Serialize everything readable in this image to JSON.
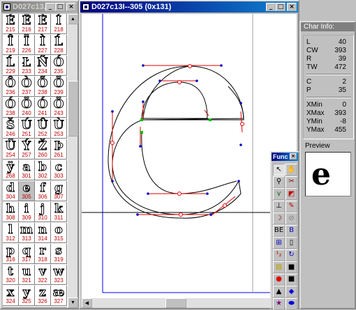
{
  "charset_window": {
    "title": "D027c13...",
    "buttons": [
      "_",
      "□",
      "×"
    ],
    "cells": [
      {
        "glyph": "É",
        "code": "215"
      },
      {
        "glyph": "Ë",
        "code": "216"
      },
      {
        "glyph": "È",
        "code": "217"
      },
      {
        "glyph": "Í",
        "code": "218"
      },
      {
        "glyph": "Î",
        "code": "219"
      },
      {
        "glyph": "Ï",
        "code": "226"
      },
      {
        "glyph": "Ì",
        "code": "227"
      },
      {
        "glyph": "Ĺ",
        "code": "228"
      },
      {
        "glyph": "Ĺ",
        "code": "229"
      },
      {
        "glyph": "Ł",
        "code": "233"
      },
      {
        "glyph": "Ñ",
        "code": "234"
      },
      {
        "glyph": "Ó",
        "code": "235"
      },
      {
        "glyph": "Ô",
        "code": "236"
      },
      {
        "glyph": "Ò",
        "code": "237"
      },
      {
        "glyph": "Õ",
        "code": "238"
      },
      {
        "glyph": "Ö",
        "code": "239"
      },
      {
        "glyph": "Ó",
        "code": "238"
      },
      {
        "glyph": "Ö",
        "code": "240"
      },
      {
        "glyph": "Ó",
        "code": "241"
      },
      {
        "glyph": "Ö",
        "code": "243"
      },
      {
        "glyph": "Š",
        "code": "246"
      },
      {
        "glyph": "Ú",
        "code": "251"
      },
      {
        "glyph": "Û",
        "code": "252"
      },
      {
        "glyph": "Ù",
        "code": "253"
      },
      {
        "glyph": "Ü",
        "code": "254"
      },
      {
        "glyph": "Ý",
        "code": "257"
      },
      {
        "glyph": "Ž",
        "code": "260"
      },
      {
        "glyph": "Þ",
        "code": "261"
      },
      {
        "glyph": "ÿ",
        "code": "268"
      },
      {
        "glyph": "a",
        "code": "301"
      },
      {
        "glyph": "b",
        "code": "302"
      },
      {
        "glyph": "c",
        "code": "303"
      },
      {
        "glyph": "d",
        "code": "304"
      },
      {
        "glyph": "e",
        "code": "305",
        "selected": true
      },
      {
        "glyph": "f",
        "code": "306"
      },
      {
        "glyph": "g",
        "code": "307"
      },
      {
        "glyph": "h",
        "code": "308"
      },
      {
        "glyph": "i",
        "code": "309"
      },
      {
        "glyph": "j",
        "code": "310"
      },
      {
        "glyph": "k",
        "code": "311"
      },
      {
        "glyph": "l",
        "code": "312"
      },
      {
        "glyph": "m",
        "code": "313"
      },
      {
        "glyph": "n",
        "code": "314"
      },
      {
        "glyph": "o",
        "code": "315"
      },
      {
        "glyph": "p",
        "code": "316"
      },
      {
        "glyph": "q",
        "code": "317"
      },
      {
        "glyph": "r",
        "code": "318"
      },
      {
        "glyph": "s",
        "code": "319"
      },
      {
        "glyph": "t",
        "code": "320"
      },
      {
        "glyph": "u",
        "code": "321"
      },
      {
        "glyph": "v",
        "code": "322"
      },
      {
        "glyph": "w",
        "code": "323"
      },
      {
        "glyph": "x",
        "code": "324"
      },
      {
        "glyph": "y",
        "code": "325"
      },
      {
        "glyph": "z",
        "code": "326"
      },
      {
        "glyph": "æ",
        "code": "327"
      }
    ]
  },
  "editor_window": {
    "title": "D027c13I--305 (0x131)",
    "buttons": [
      "_",
      "□",
      "×"
    ]
  },
  "char_info": {
    "title": "Char Info:",
    "metrics": [
      {
        "label": "L",
        "value": "40"
      },
      {
        "label": "CW",
        "value": "393"
      },
      {
        "label": "R",
        "value": "39"
      },
      {
        "label": "TW",
        "value": "472"
      }
    ],
    "counts": [
      {
        "label": "C",
        "value": "2"
      },
      {
        "label": "P",
        "value": "35"
      }
    ],
    "bounds": [
      {
        "label": "XMin",
        "value": "0"
      },
      {
        "label": "XMax",
        "value": "393"
      },
      {
        "label": "YMin",
        "value": "-8"
      },
      {
        "label": "YMax",
        "value": "455"
      }
    ],
    "preview_label": "Preview",
    "preview_glyph": "e"
  },
  "func_palette": {
    "title": "Func",
    "tools": [
      {
        "name": "pointer-tool-icon",
        "glyph": "↖",
        "color": "#000000"
      },
      {
        "name": "hand-tool-icon",
        "glyph": "✋",
        "color": "#c08000"
      },
      {
        "name": "zoom-tool-icon",
        "glyph": "⚲",
        "color": "#000000"
      },
      {
        "name": "knife-tool-icon",
        "glyph": "✂",
        "color": "#800000"
      },
      {
        "name": "node-tool-icon",
        "glyph": "⋎",
        "color": "#006000"
      },
      {
        "name": "transform-tool-icon",
        "glyph": "◩",
        "color": "#c00000"
      },
      {
        "name": "measure-tool-icon",
        "glyph": "⊥",
        "color": "#000000"
      },
      {
        "name": "pen-tool-icon",
        "glyph": "✎",
        "color": "#c00000"
      },
      {
        "name": "curve-tool-icon",
        "glyph": "☽",
        "color": "#800000"
      },
      {
        "name": "blank-tool-icon",
        "glyph": "⊘",
        "color": "#808080"
      },
      {
        "name": "be-tool-icon",
        "glyph": "BE",
        "color": "#000000"
      },
      {
        "name": "b-tool-icon",
        "glyph": "B",
        "color": "#0000c0"
      },
      {
        "name": "fill-tool-icon",
        "glyph": "⊞",
        "color": "#0000c0"
      },
      {
        "name": "column-tool-icon",
        "glyph": "▯",
        "color": "#000000"
      },
      {
        "name": "number-tool-icon",
        "glyph": "¹₂",
        "color": "#c00000"
      },
      {
        "name": "rotate-tool-icon",
        "glyph": "↻",
        "color": "#0000c0"
      },
      {
        "name": "layer-tool-icon",
        "glyph": "▨",
        "color": "#c0a000"
      },
      {
        "name": "square-tool-icon",
        "glyph": "■",
        "color": "#000000"
      },
      {
        "name": "circle-tool-icon",
        "glyph": "●",
        "color": "#e00000"
      },
      {
        "name": "square-black-tool-icon",
        "glyph": "■",
        "color": "#000000"
      },
      {
        "name": "triangle-tool-icon",
        "glyph": "▲",
        "color": "#000000"
      },
      {
        "name": "diamond-tool-icon",
        "glyph": "◆",
        "color": "#0000e0"
      },
      {
        "name": "star-tool-icon",
        "glyph": "★",
        "color": "#800080"
      },
      {
        "name": "ellipse-tool-icon",
        "glyph": "⬬",
        "color": "#0000e0"
      }
    ]
  }
}
